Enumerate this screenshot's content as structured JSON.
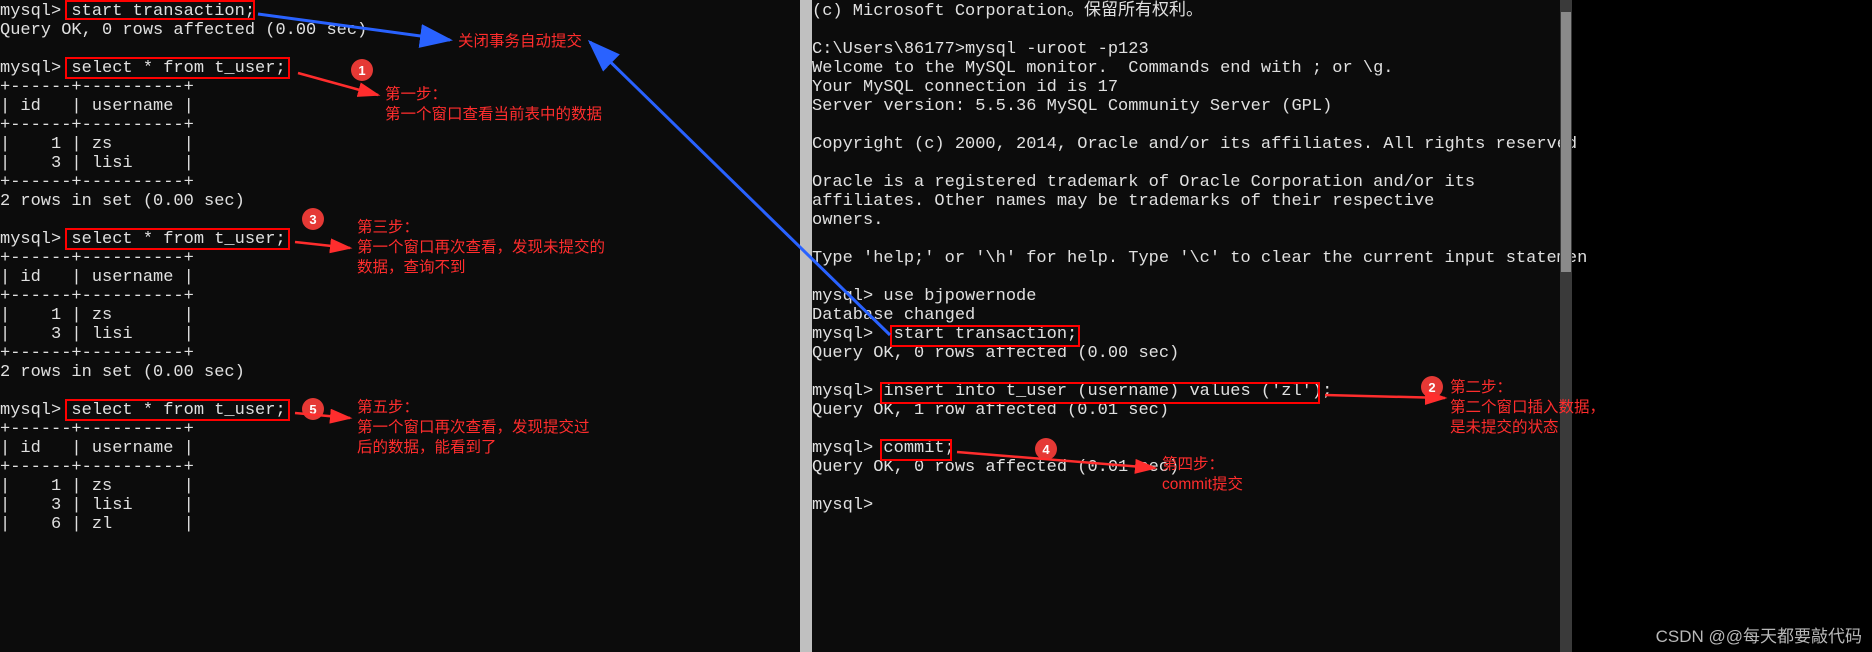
{
  "left_pane": {
    "lines": [
      "mysql> start transaction;",
      "Query OK, 0 rows affected (0.00 sec)",
      "",
      "mysql> select * from t_user;",
      "+------+----------+",
      "| id   | username |",
      "+------+----------+",
      "|    1 | zs       |",
      "|    3 | lisi     |",
      "+------+----------+",
      "2 rows in set (0.00 sec)",
      "",
      "mysql> select * from t_user;",
      "+------+----------+",
      "| id   | username |",
      "+------+----------+",
      "|    1 | zs       |",
      "|    3 | lisi     |",
      "+------+----------+",
      "2 rows in set (0.00 sec)",
      "",
      "mysql> select * from t_user;",
      "+------+----------+",
      "| id   | username |",
      "+------+----------+",
      "|    1 | zs       |",
      "|    3 | lisi     |",
      "|    6 | zl       |"
    ]
  },
  "right_pane": {
    "lines": [
      "(c) Microsoft Corporation。保留所有权利。",
      "",
      "C:\\Users\\86177>mysql -uroot -p123",
      "Welcome to the MySQL monitor.  Commands end with ; or \\g.",
      "Your MySQL connection id is 17",
      "Server version: 5.5.36 MySQL Community Server (GPL)",
      "",
      "Copyright (c) 2000, 2014, Oracle and/or its affiliates. All rights reserved",
      "",
      "Oracle is a registered trademark of Oracle Corporation and/or its",
      "affiliates. Other names may be trademarks of their respective",
      "owners.",
      "",
      "Type 'help;' or '\\h' for help. Type '\\c' to clear the current input statemen",
      "",
      "mysql> use bjpowernode",
      "Database changed",
      "mysql>  start transaction;",
      "Query OK, 0 rows affected (0.00 sec)",
      "",
      "mysql> insert into t_user (username) values ('zl');",
      "Query OK, 1 row affected (0.01 sec)",
      "",
      "mysql> commit;",
      "Query OK, 0 rows affected (0.01 sec)",
      "",
      "mysql>"
    ]
  },
  "annotations": {
    "close_auto": "关闭事务自动提交",
    "step1_title": "第一步：",
    "step1_body": "第一个窗口查看当前表中的数据",
    "step2_title": "第二步：",
    "step2_body1": "第二个窗口插入数据，",
    "step2_body2": "是未提交的状态",
    "step3_title": "第三步：",
    "step3_body1": "第一个窗口再次查看，发现未提交的",
    "step3_body2": "数据，查询不到",
    "step4_title": "第四步：",
    "step4_body": "commit提交",
    "step5_title": "第五步：",
    "step5_body1": "第一个窗口再次查看，发现提交过",
    "step5_body2": "后的数据，能看到了"
  },
  "badges": {
    "b1": "1",
    "b2": "2",
    "b3": "3",
    "b4": "4",
    "b5": "5"
  },
  "watermark": "CSDN @@每天都要敲代码"
}
